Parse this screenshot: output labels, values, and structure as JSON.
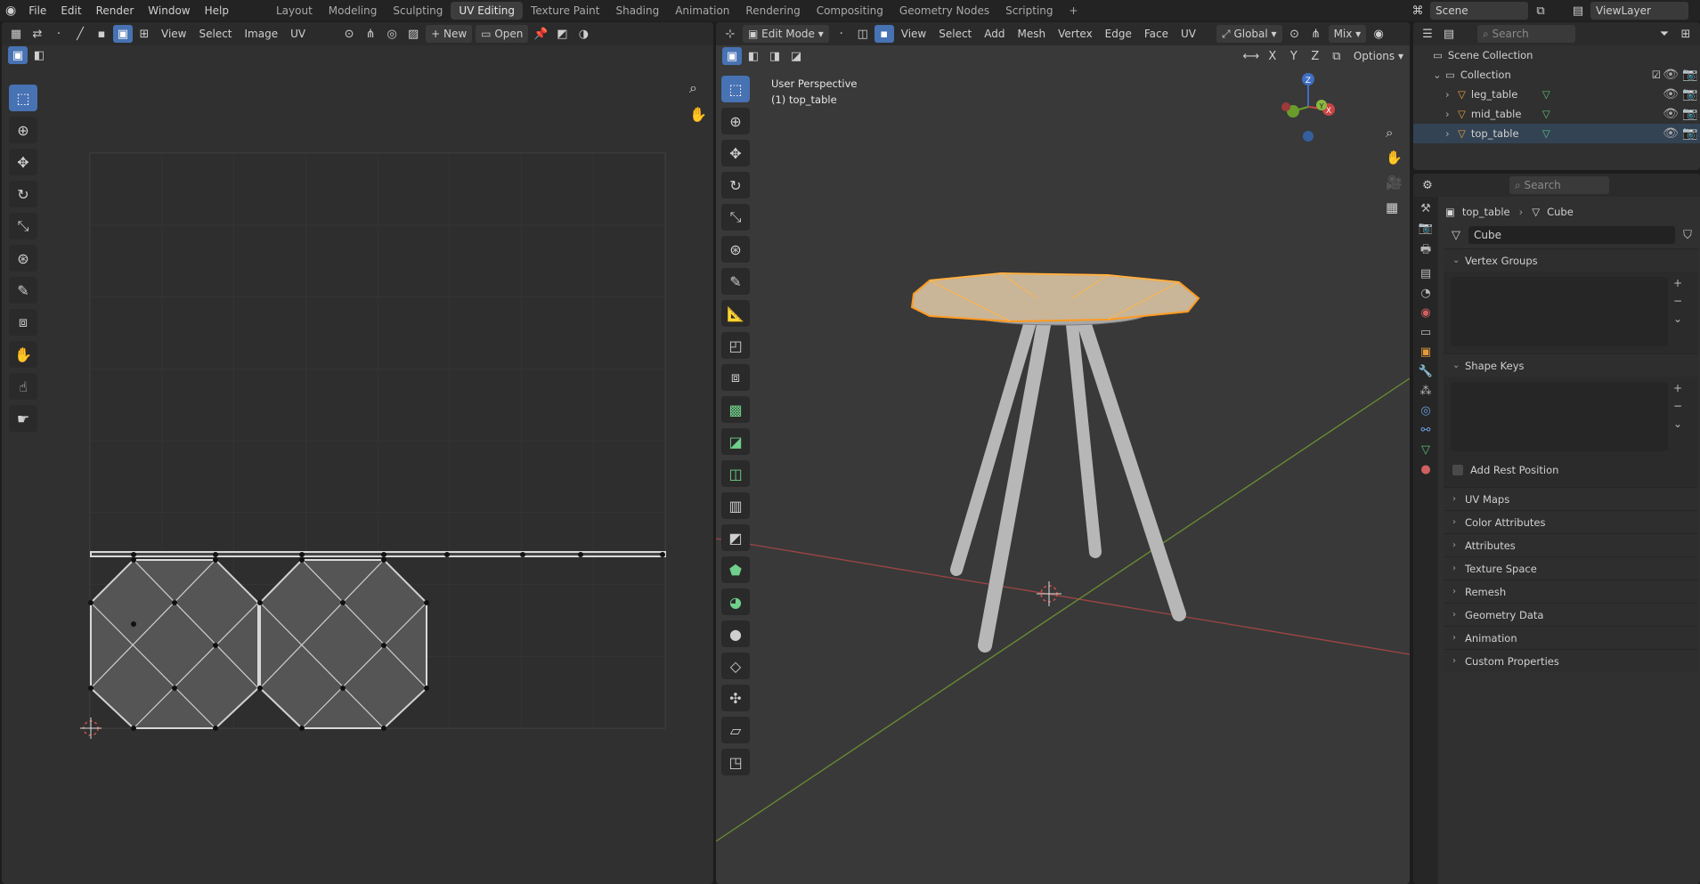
{
  "topbar": {
    "menus": [
      "File",
      "Edit",
      "Render",
      "Window",
      "Help"
    ],
    "workspaces": [
      "Layout",
      "Modeling",
      "Sculpting",
      "UV Editing",
      "Texture Paint",
      "Shading",
      "Animation",
      "Rendering",
      "Compositing",
      "Geometry Nodes",
      "Scripting"
    ],
    "active_workspace": "UV Editing",
    "add_tab": "+",
    "scene": "Scene",
    "view_layer": "ViewLayer"
  },
  "uv_editor": {
    "menus": [
      "View",
      "Select",
      "Image",
      "UV"
    ],
    "new_label": "New",
    "open_label": "Open"
  },
  "viewport": {
    "mode": "Edit Mode",
    "menus": [
      "View",
      "Select",
      "Add",
      "Mesh",
      "Vertex",
      "Edge",
      "Face",
      "UV"
    ],
    "orientation": "Global",
    "shading": "Mix",
    "axis_x": "X",
    "axis_y": "Y",
    "axis_z": "Z",
    "options": "Options",
    "overlay_line1": "User Perspective",
    "overlay_line2": "(1) top_table",
    "gizmo": {
      "x": "X",
      "y": "Y",
      "z": "Z"
    },
    "colors": {
      "selection": "#ff9a1f",
      "x_axis": "#b54a4a",
      "y_axis": "#7aa33a",
      "legs": "#b7b7b7"
    }
  },
  "outliner": {
    "search_placeholder": "Search",
    "scene_collection": "Scene Collection",
    "collection": "Collection",
    "items": [
      {
        "name": "leg_table",
        "icon": "mesh-icon"
      },
      {
        "name": "mid_table",
        "icon": "mesh-icon"
      },
      {
        "name": "top_table",
        "icon": "mesh-icon"
      }
    ]
  },
  "properties": {
    "search_placeholder": "Search",
    "breadcrumb_object": "top_table",
    "breadcrumb_mesh": "Cube",
    "mesh_name": "Cube",
    "sections": {
      "vertex_groups": "Vertex Groups",
      "shape_keys": "Shape Keys",
      "add_rest_position": "Add Rest Position",
      "collapsed": [
        "UV Maps",
        "Color Attributes",
        "Attributes",
        "Texture Space",
        "Remesh",
        "Geometry Data",
        "Animation",
        "Custom Properties"
      ]
    }
  }
}
